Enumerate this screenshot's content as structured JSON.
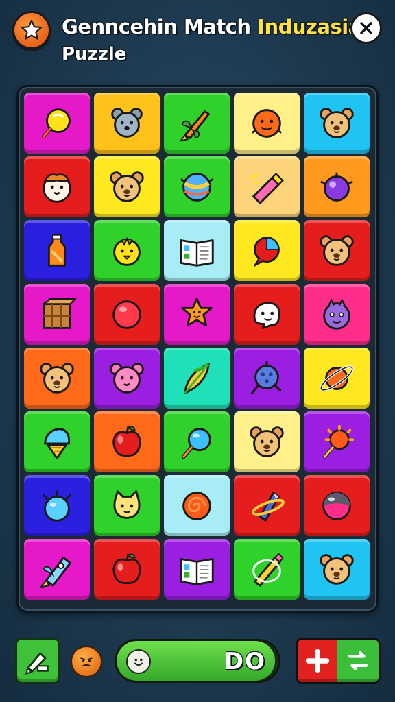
{
  "header": {
    "title_main": "Genncehin Match ",
    "title_highlight": "Induzasia",
    "subtitle": "Puzzle"
  },
  "board": {
    "columns": 5,
    "rows": 8,
    "tiles": [
      {
        "color": "#e619c9",
        "icon": "lollipop"
      },
      {
        "color": "#ffc21a",
        "icon": "mouse-face"
      },
      {
        "color": "#2fd12a",
        "icon": "rocket"
      },
      {
        "color": "#fff08a",
        "icon": "orange-face"
      },
      {
        "color": "#1fc4f2",
        "icon": "bear-face"
      },
      {
        "color": "#e61d1d",
        "icon": "hamster-face"
      },
      {
        "color": "#ffe81f",
        "icon": "bear-face"
      },
      {
        "color": "#2fd12a",
        "icon": "beach-ball"
      },
      {
        "color": "#fcd47a",
        "icon": "crayon"
      },
      {
        "color": "#ff9a1f",
        "icon": "purple-orb"
      },
      {
        "color": "#2b1fe0",
        "icon": "juice-bottle"
      },
      {
        "color": "#2fd12a",
        "icon": "chick-face"
      },
      {
        "color": "#a8ecf5",
        "icon": "open-book"
      },
      {
        "color": "#ffe81f",
        "icon": "speech-ball"
      },
      {
        "color": "#e61d1d",
        "icon": "bear-face"
      },
      {
        "color": "#e619c9",
        "icon": "crate"
      },
      {
        "color": "#e61d1d",
        "icon": "red-ball"
      },
      {
        "color": "#e619c9",
        "icon": "star-face"
      },
      {
        "color": "#e61d1d",
        "icon": "ghost-face"
      },
      {
        "color": "#ff2e8a",
        "icon": "monster-face"
      },
      {
        "color": "#ff6a1a",
        "icon": "bear-face"
      },
      {
        "color": "#9b1fe0",
        "icon": "pink-bear"
      },
      {
        "color": "#1fe0b8",
        "icon": "feather"
      },
      {
        "color": "#9b1fe0",
        "icon": "turtle"
      },
      {
        "color": "#ffe81f",
        "icon": "planet"
      },
      {
        "color": "#2fd12a",
        "icon": "ice-cream"
      },
      {
        "color": "#ff6a1a",
        "icon": "apple"
      },
      {
        "color": "#2fd12a",
        "icon": "magnifier"
      },
      {
        "color": "#fff08a",
        "icon": "bear-face"
      },
      {
        "color": "#9b1fe0",
        "icon": "sun-lollipop"
      },
      {
        "color": "#2b1fe0",
        "icon": "blue-bomb"
      },
      {
        "color": "#2fd12a",
        "icon": "cat-face"
      },
      {
        "color": "#a8ecf5",
        "icon": "swirl-ball"
      },
      {
        "color": "#e61d1d",
        "icon": "ringed-crystal"
      },
      {
        "color": "#e61d1d",
        "icon": "dark-orb"
      },
      {
        "color": "#e619c9",
        "icon": "rocket-blue"
      },
      {
        "color": "#e61d1d",
        "icon": "apple"
      },
      {
        "color": "#9b1fe0",
        "icon": "open-book"
      },
      {
        "color": "#2fd12a",
        "icon": "pencil-ring"
      },
      {
        "color": "#1fc4f2",
        "icon": "bear-face"
      }
    ]
  },
  "footer": {
    "progress_label": "DO",
    "progress_fraction": 0.98
  }
}
